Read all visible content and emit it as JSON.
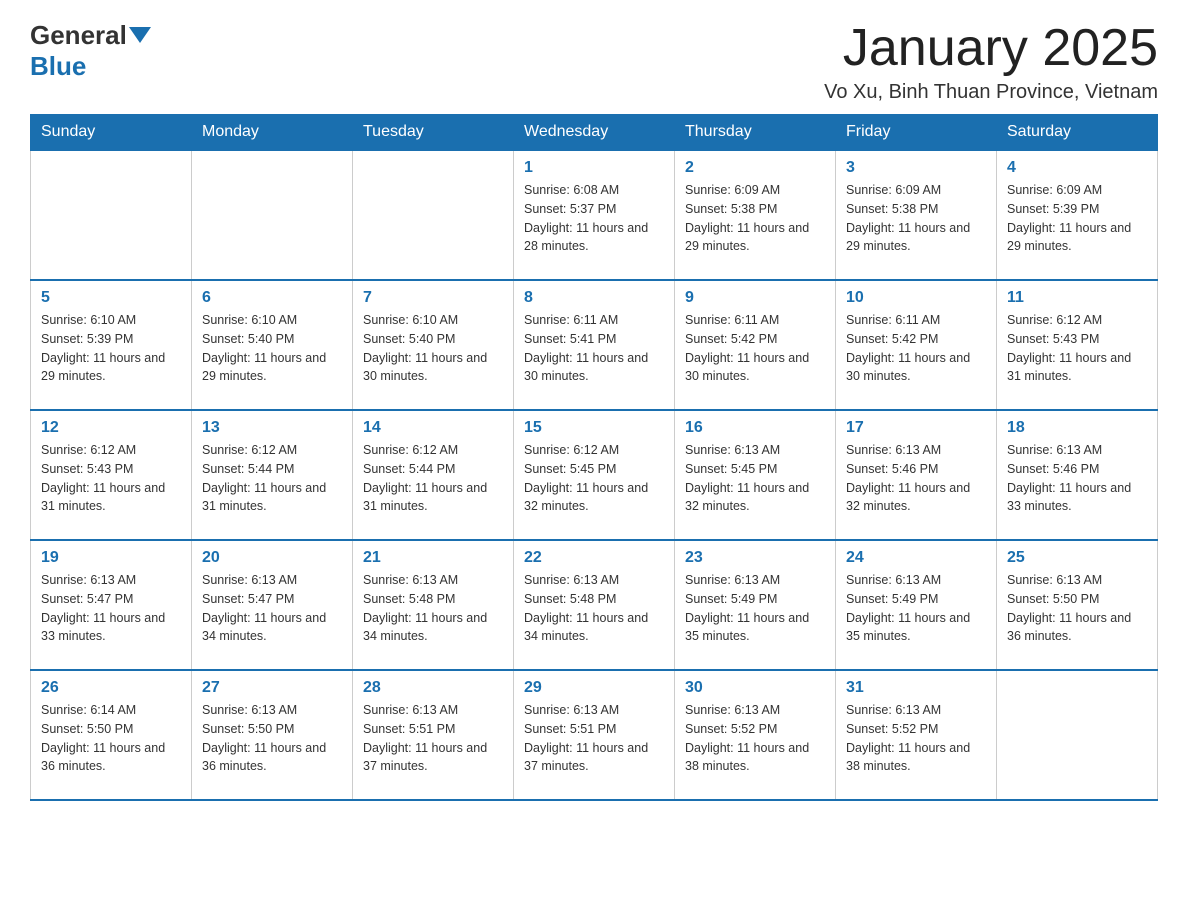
{
  "header": {
    "logo_general": "General",
    "logo_blue": "Blue",
    "month_title": "January 2025",
    "location": "Vo Xu, Binh Thuan Province, Vietnam"
  },
  "days_of_week": [
    "Sunday",
    "Monday",
    "Tuesday",
    "Wednesday",
    "Thursday",
    "Friday",
    "Saturday"
  ],
  "weeks": [
    [
      {
        "day": "",
        "info": ""
      },
      {
        "day": "",
        "info": ""
      },
      {
        "day": "",
        "info": ""
      },
      {
        "day": "1",
        "info": "Sunrise: 6:08 AM\nSunset: 5:37 PM\nDaylight: 11 hours and 28 minutes."
      },
      {
        "day": "2",
        "info": "Sunrise: 6:09 AM\nSunset: 5:38 PM\nDaylight: 11 hours and 29 minutes."
      },
      {
        "day": "3",
        "info": "Sunrise: 6:09 AM\nSunset: 5:38 PM\nDaylight: 11 hours and 29 minutes."
      },
      {
        "day": "4",
        "info": "Sunrise: 6:09 AM\nSunset: 5:39 PM\nDaylight: 11 hours and 29 minutes."
      }
    ],
    [
      {
        "day": "5",
        "info": "Sunrise: 6:10 AM\nSunset: 5:39 PM\nDaylight: 11 hours and 29 minutes."
      },
      {
        "day": "6",
        "info": "Sunrise: 6:10 AM\nSunset: 5:40 PM\nDaylight: 11 hours and 29 minutes."
      },
      {
        "day": "7",
        "info": "Sunrise: 6:10 AM\nSunset: 5:40 PM\nDaylight: 11 hours and 30 minutes."
      },
      {
        "day": "8",
        "info": "Sunrise: 6:11 AM\nSunset: 5:41 PM\nDaylight: 11 hours and 30 minutes."
      },
      {
        "day": "9",
        "info": "Sunrise: 6:11 AM\nSunset: 5:42 PM\nDaylight: 11 hours and 30 minutes."
      },
      {
        "day": "10",
        "info": "Sunrise: 6:11 AM\nSunset: 5:42 PM\nDaylight: 11 hours and 30 minutes."
      },
      {
        "day": "11",
        "info": "Sunrise: 6:12 AM\nSunset: 5:43 PM\nDaylight: 11 hours and 31 minutes."
      }
    ],
    [
      {
        "day": "12",
        "info": "Sunrise: 6:12 AM\nSunset: 5:43 PM\nDaylight: 11 hours and 31 minutes."
      },
      {
        "day": "13",
        "info": "Sunrise: 6:12 AM\nSunset: 5:44 PM\nDaylight: 11 hours and 31 minutes."
      },
      {
        "day": "14",
        "info": "Sunrise: 6:12 AM\nSunset: 5:44 PM\nDaylight: 11 hours and 31 minutes."
      },
      {
        "day": "15",
        "info": "Sunrise: 6:12 AM\nSunset: 5:45 PM\nDaylight: 11 hours and 32 minutes."
      },
      {
        "day": "16",
        "info": "Sunrise: 6:13 AM\nSunset: 5:45 PM\nDaylight: 11 hours and 32 minutes."
      },
      {
        "day": "17",
        "info": "Sunrise: 6:13 AM\nSunset: 5:46 PM\nDaylight: 11 hours and 32 minutes."
      },
      {
        "day": "18",
        "info": "Sunrise: 6:13 AM\nSunset: 5:46 PM\nDaylight: 11 hours and 33 minutes."
      }
    ],
    [
      {
        "day": "19",
        "info": "Sunrise: 6:13 AM\nSunset: 5:47 PM\nDaylight: 11 hours and 33 minutes."
      },
      {
        "day": "20",
        "info": "Sunrise: 6:13 AM\nSunset: 5:47 PM\nDaylight: 11 hours and 34 minutes."
      },
      {
        "day": "21",
        "info": "Sunrise: 6:13 AM\nSunset: 5:48 PM\nDaylight: 11 hours and 34 minutes."
      },
      {
        "day": "22",
        "info": "Sunrise: 6:13 AM\nSunset: 5:48 PM\nDaylight: 11 hours and 34 minutes."
      },
      {
        "day": "23",
        "info": "Sunrise: 6:13 AM\nSunset: 5:49 PM\nDaylight: 11 hours and 35 minutes."
      },
      {
        "day": "24",
        "info": "Sunrise: 6:13 AM\nSunset: 5:49 PM\nDaylight: 11 hours and 35 minutes."
      },
      {
        "day": "25",
        "info": "Sunrise: 6:13 AM\nSunset: 5:50 PM\nDaylight: 11 hours and 36 minutes."
      }
    ],
    [
      {
        "day": "26",
        "info": "Sunrise: 6:14 AM\nSunset: 5:50 PM\nDaylight: 11 hours and 36 minutes."
      },
      {
        "day": "27",
        "info": "Sunrise: 6:13 AM\nSunset: 5:50 PM\nDaylight: 11 hours and 36 minutes."
      },
      {
        "day": "28",
        "info": "Sunrise: 6:13 AM\nSunset: 5:51 PM\nDaylight: 11 hours and 37 minutes."
      },
      {
        "day": "29",
        "info": "Sunrise: 6:13 AM\nSunset: 5:51 PM\nDaylight: 11 hours and 37 minutes."
      },
      {
        "day": "30",
        "info": "Sunrise: 6:13 AM\nSunset: 5:52 PM\nDaylight: 11 hours and 38 minutes."
      },
      {
        "day": "31",
        "info": "Sunrise: 6:13 AM\nSunset: 5:52 PM\nDaylight: 11 hours and 38 minutes."
      },
      {
        "day": "",
        "info": ""
      }
    ]
  ]
}
